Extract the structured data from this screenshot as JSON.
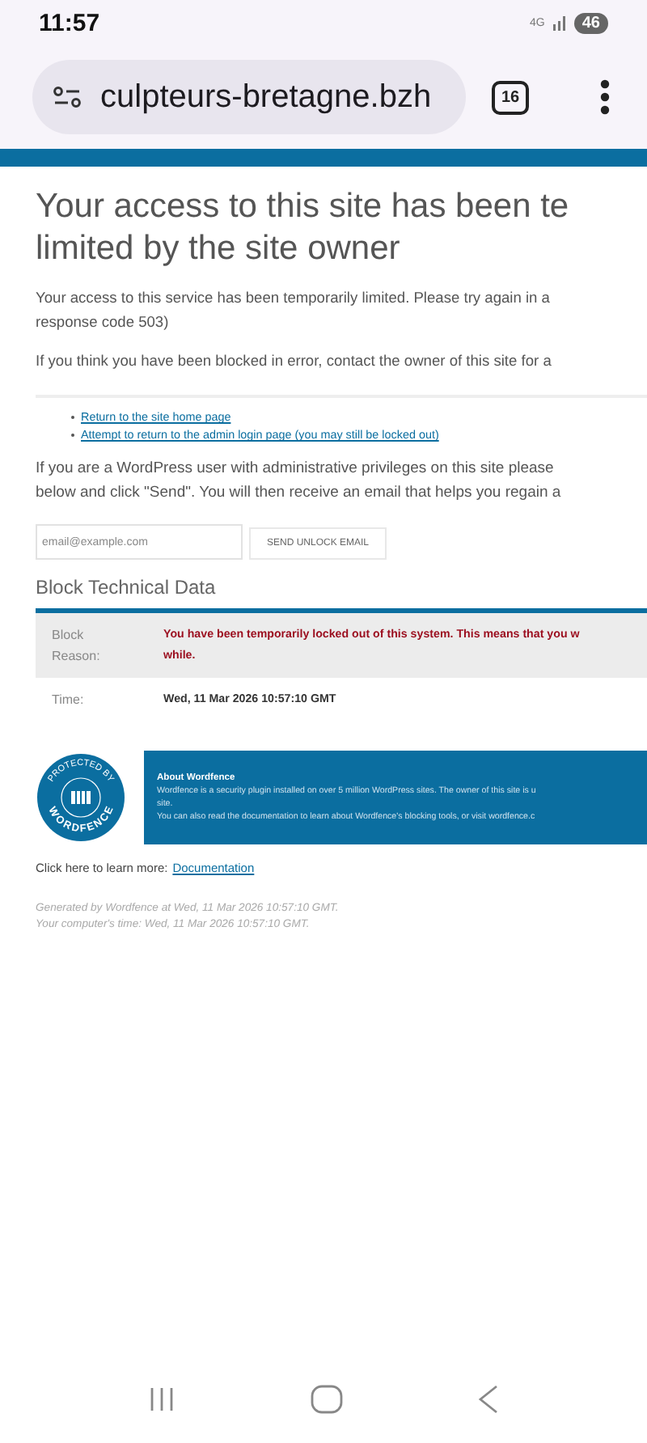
{
  "status_bar": {
    "time": "11:57",
    "network": "4G",
    "battery": "46"
  },
  "browser": {
    "url": "culpteurs-bretagne.bzh",
    "tab_count": "16"
  },
  "heading": [
    "Your access to this site has been te",
    "limited by the site owner"
  ],
  "intro": [
    "Your access to this service has been temporarily limited. Please try again in a",
    "response code 503)"
  ],
  "contact": "If you think you have been blocked in error, contact the owner of this site for a",
  "links": [
    "Return to the site home page",
    "Attempt to return to the admin login page (you may still be locked out)"
  ],
  "admin_note": [
    "If you are a WordPress user with administrative privileges on this site please",
    "below and click \"Send\". You will then receive an email that helps you regain a"
  ],
  "email": {
    "placeholder": "email@example.com",
    "button": "SEND UNLOCK EMAIL"
  },
  "block_data": {
    "title": "Block Technical Data",
    "rows": [
      {
        "label": [
          "Block",
          "Reason:"
        ],
        "value": [
          "You have been temporarily locked out of this system. This means that you w",
          "while."
        ],
        "kind": "reason"
      },
      {
        "label": [
          "Time:"
        ],
        "value": [
          "Wed, 11 Mar 2026 10:57:10 GMT"
        ],
        "kind": "time"
      }
    ]
  },
  "badge": {
    "top": "PROTECTED BY",
    "bottom": "WORDFENCE"
  },
  "about": {
    "title": "About Wordfence",
    "lines": [
      "Wordfence is a security plugin installed on over 5 million WordPress sites. The owner of this site is u",
      "site.",
      "You can also read the documentation to learn about Wordfence's blocking tools, or visit wordfence.c"
    ]
  },
  "learn_more": {
    "text": "Click here to learn more:",
    "link": "Documentation"
  },
  "footer": [
    "Generated by Wordfence at Wed, 11 Mar 2026 10:57:10 GMT.",
    "Your computer's time: Wed, 11 Mar 2026 10:57:10 GMT."
  ]
}
